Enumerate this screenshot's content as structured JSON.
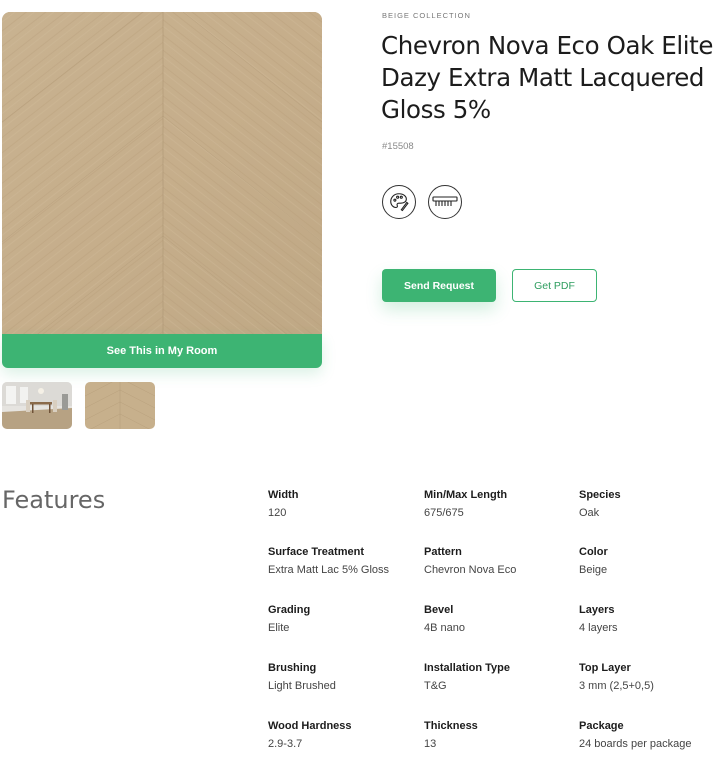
{
  "gallery": {
    "room_button_label": "See This in My Room"
  },
  "product": {
    "collection": "BEIGE COLLECTION",
    "title": "Chevron Nova Eco Oak Elite Dazy Extra Matt Lacquered Gloss 5%",
    "sku": "#15508",
    "icons": [
      "palette-icon",
      "comb-icon"
    ]
  },
  "actions": {
    "send_request_label": "Send Request",
    "get_pdf_label": "Get PDF"
  },
  "features": {
    "title": "Features",
    "items": [
      {
        "label": "Width",
        "value": "120"
      },
      {
        "label": "Min/Max Length",
        "value": "675/675"
      },
      {
        "label": "Species",
        "value": "Oak"
      },
      {
        "label": "Surface Treatment",
        "value": "Extra Matt Lac 5% Gloss"
      },
      {
        "label": "Pattern",
        "value": "Chevron Nova Eco"
      },
      {
        "label": "Color",
        "value": "Beige"
      },
      {
        "label": "Grading",
        "value": "Elite"
      },
      {
        "label": "Bevel",
        "value": "4B nano"
      },
      {
        "label": "Layers",
        "value": "4 layers"
      },
      {
        "label": "Brushing",
        "value": "Light Brushed"
      },
      {
        "label": "Installation Type",
        "value": "T&G"
      },
      {
        "label": "Top Layer",
        "value": "3 mm (2,5+0,5)"
      },
      {
        "label": "Wood Hardness",
        "value": "2.9-3.7"
      },
      {
        "label": "Thickness",
        "value": "13"
      },
      {
        "label": "Package",
        "value": "24 boards per package"
      }
    ]
  },
  "colors": {
    "accent": "#3db473",
    "wood": "#c9b391"
  }
}
